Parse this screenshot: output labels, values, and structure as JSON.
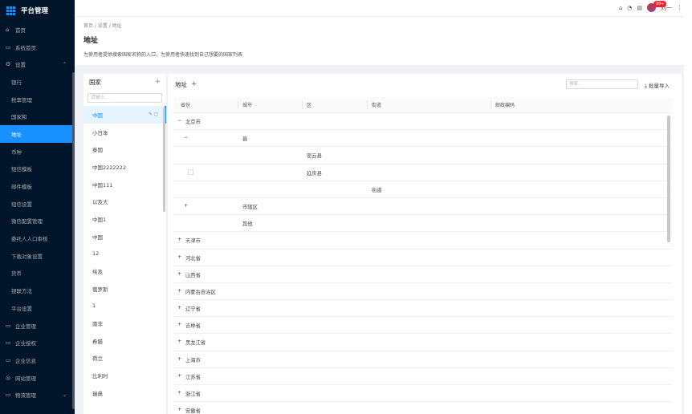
{
  "app": {
    "title": "平台管理"
  },
  "sidebar": {
    "items": [
      {
        "icon": "home-icon",
        "glyph": "⌂",
        "label": "首页",
        "sub": false
      },
      {
        "icon": "window-icon",
        "glyph": "▭",
        "label": "系统首页",
        "sub": false
      },
      {
        "icon": "gear-icon",
        "glyph": "⚙",
        "label": "设置",
        "sub": false,
        "arrow": "⌃"
      },
      {
        "label": "银行",
        "sub": true
      },
      {
        "label": "税率管理",
        "sub": true
      },
      {
        "label": "国家和",
        "sub": true
      },
      {
        "label": "地址",
        "sub": true,
        "active": true
      },
      {
        "label": "币种",
        "sub": true
      },
      {
        "label": "短信模板",
        "sub": true
      },
      {
        "label": "邮件模板",
        "sub": true
      },
      {
        "label": "短信设置",
        "sub": true
      },
      {
        "label": "微信配置管理",
        "sub": true
      },
      {
        "label": "委托人人口审核",
        "sub": true
      },
      {
        "label": "下载对象设置",
        "sub": true
      },
      {
        "label": "货币",
        "sub": true
      },
      {
        "label": "银联方法",
        "sub": true
      },
      {
        "label": "平台设置",
        "sub": true
      },
      {
        "icon": "window-icon",
        "glyph": "▭",
        "label": "企业管理",
        "sub": false
      },
      {
        "icon": "window-icon",
        "glyph": "▭",
        "label": "企业授权",
        "sub": false
      },
      {
        "icon": "window-icon",
        "glyph": "▭",
        "label": "企业信息",
        "sub": false
      },
      {
        "icon": "global-icon",
        "glyph": "◎",
        "label": "网站管理",
        "sub": false
      },
      {
        "icon": "window-icon",
        "glyph": "▭",
        "label": "物流管理",
        "sub": false,
        "arrow": "⌄"
      }
    ]
  },
  "topbar": {
    "badge": "99+",
    "user": "刘一",
    "more": "⋮"
  },
  "breadcrumb": "首页 / 设置 / 地址",
  "page": {
    "title": "地址",
    "description": "为使用者提供搜索国家名称的入口，为使用者快速找到自己想要的国家列表"
  },
  "countries": {
    "title": "国家",
    "search_placeholder": "请输入...",
    "items": [
      "中国",
      "小日本",
      "泰国",
      "中国2222222",
      "中国111",
      "以及大",
      "中国1",
      "中国",
      "12",
      "埃及",
      "俄罗斯",
      "1",
      "南非",
      "希腊",
      "荷兰",
      "比利时",
      "瑞典"
    ],
    "active_index": 0
  },
  "addresses": {
    "title": "地址",
    "search_placeholder": "搜索...",
    "import_label": "批量导入",
    "columns": [
      "省份",
      "城市",
      "区",
      "街道",
      "邮政编码"
    ],
    "rows": [
      {
        "toggle": "−",
        "province": "北京市"
      },
      {
        "toggle": "−",
        "city": "县",
        "level": 1
      },
      {
        "district": "密云县"
      },
      {
        "district": "延庆县",
        "checkbox": true
      },
      {
        "street": "街道"
      },
      {
        "toggle": "+",
        "city": "市辖区",
        "level": 1
      },
      {
        "city": "其他"
      },
      {
        "toggle": "+",
        "province": "天津市"
      },
      {
        "toggle": "+",
        "province": "河北省"
      },
      {
        "toggle": "+",
        "province": "山西省"
      },
      {
        "toggle": "+",
        "province": "内蒙古自治区"
      },
      {
        "toggle": "+",
        "province": "辽宁省"
      },
      {
        "toggle": "+",
        "province": "吉林省"
      },
      {
        "toggle": "+",
        "province": "黑龙江省"
      },
      {
        "toggle": "+",
        "province": "上海市"
      },
      {
        "toggle": "+",
        "province": "江苏省"
      },
      {
        "toggle": "+",
        "province": "浙江省"
      },
      {
        "toggle": "+",
        "province": "安徽省"
      }
    ]
  },
  "colors": {
    "sidebar_bg": "#001529",
    "accent": "#1890ff",
    "badge": "#f5222d"
  }
}
